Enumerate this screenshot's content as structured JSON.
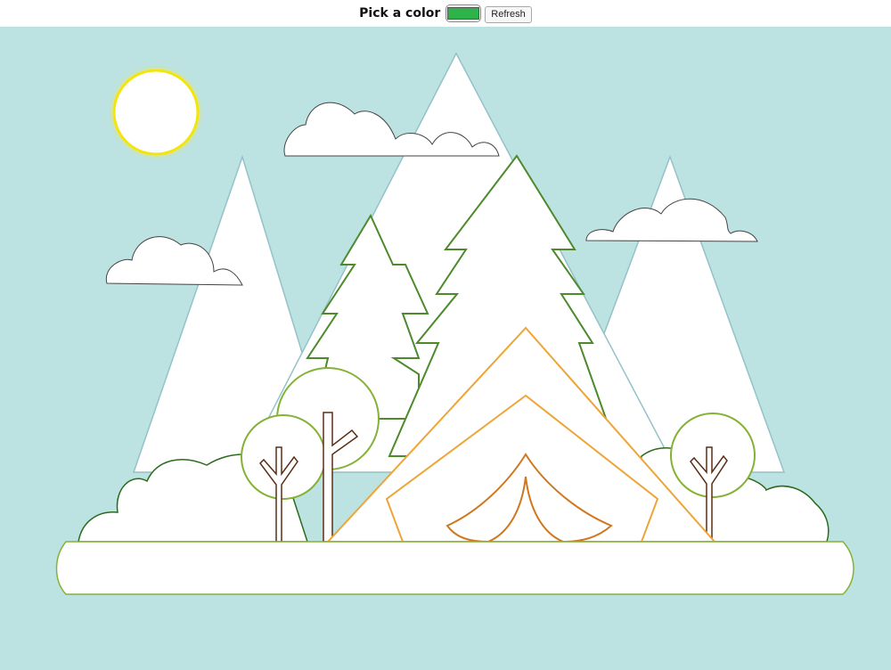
{
  "toolbar": {
    "label": "Pick a color",
    "selected_color": "#2db34a",
    "refresh_label": "Refresh"
  },
  "colors": {
    "sky": "#bce3e1",
    "mountain_outline": "#94c2c8",
    "cloud_outline": "#444444",
    "sun_outline": "#f2e40a",
    "pine_outline": "#4d8a2c",
    "leafy_outline": "#84b236",
    "bush_outline": "#2b6b1e",
    "trunk_outline": "#5b2e16",
    "tent_outline": "#eea537",
    "tent_door_outline": "#d0781f",
    "ground_outline": "#84b236",
    "fill": "#ffffff"
  }
}
